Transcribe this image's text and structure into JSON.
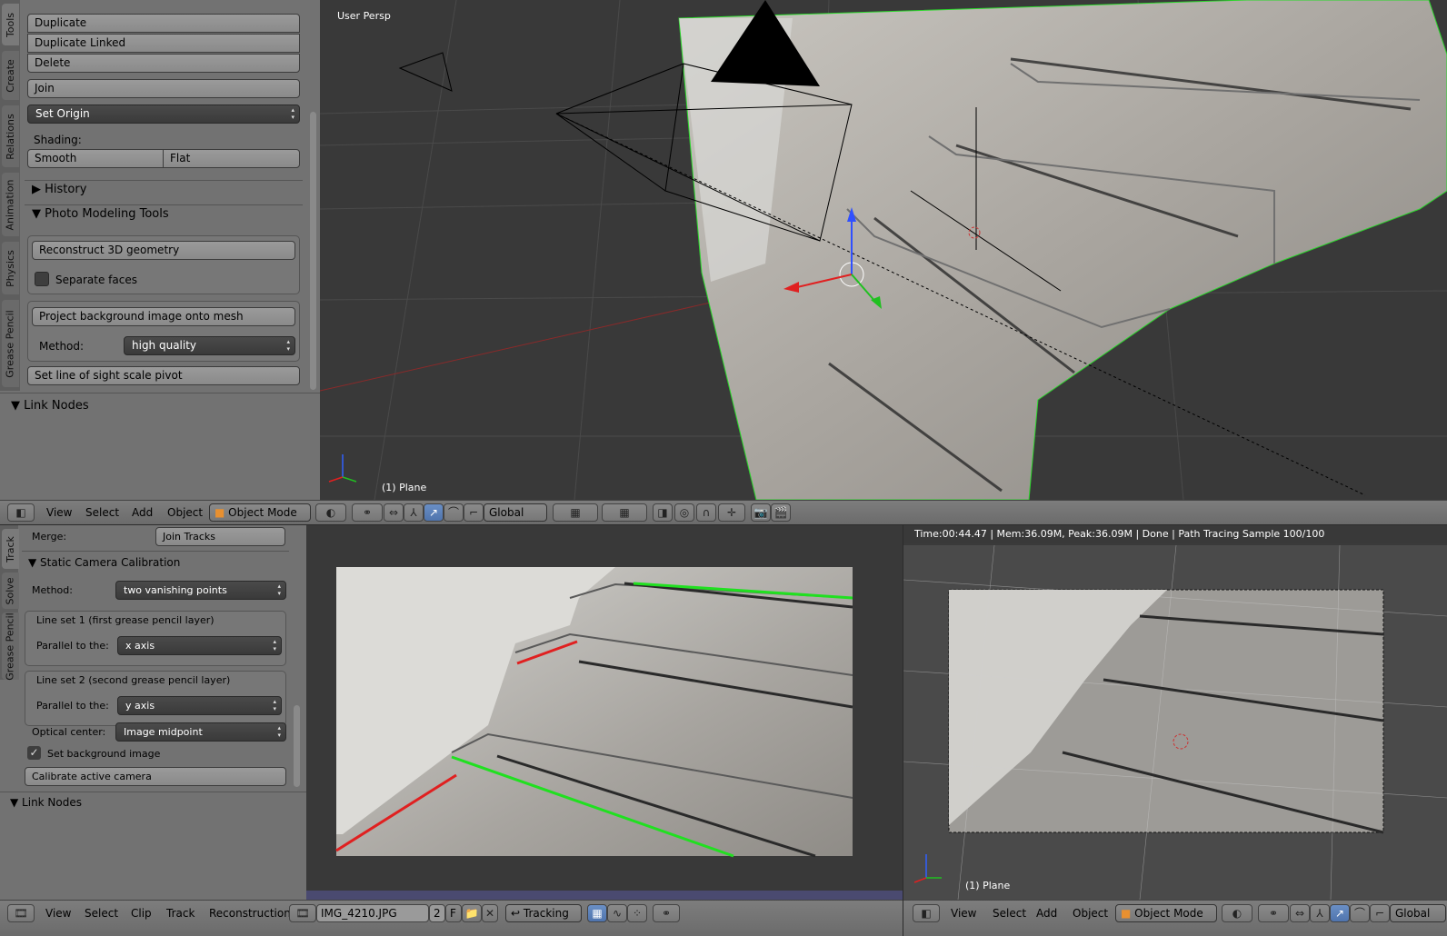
{
  "tool_panel": {
    "tabs": [
      "Tools",
      "Create",
      "Relations",
      "Animation",
      "Physics",
      "Grease Pencil"
    ],
    "buttons": {
      "duplicate": "Duplicate",
      "duplicate_linked": "Duplicate Linked",
      "delete": "Delete",
      "join": "Join"
    },
    "set_origin": "Set Origin",
    "shading_label": "Shading:",
    "smooth": "Smooth",
    "flat": "Flat",
    "history": "History",
    "photo_modeling": "Photo Modeling Tools",
    "reconstruct": "Reconstruct 3D geometry",
    "separate_faces": "Separate faces",
    "separate_faces_checked": false,
    "project": "Project background image onto mesh",
    "method_label": "Method:",
    "method_value": "high quality",
    "scale_pivot": "Set line of sight scale pivot",
    "link_nodes": "Link Nodes"
  },
  "viewport_top": {
    "title": "User Persp",
    "object": "(1) Plane"
  },
  "header_3d": {
    "menus": [
      "View",
      "Select",
      "Add",
      "Object"
    ],
    "mode": "Object Mode",
    "orientation": "Global"
  },
  "clip_panel": {
    "tabs": [
      "Track",
      "Solve",
      "Grease Pencil"
    ],
    "merge_label": "Merge:",
    "join_tracks": "Join Tracks",
    "section": "Static Camera Calibration",
    "method_label": "Method:",
    "method_value": "two vanishing points",
    "lineset1": "Line set 1 (first grease pencil layer)",
    "parallel_label": "Parallel to the:",
    "lineset1_axis": "x axis",
    "lineset2": "Line set 2 (second grease pencil layer)",
    "lineset2_axis": "y axis",
    "optical_label": "Optical center:",
    "optical_value": "Image midpoint",
    "set_bg": "Set background image",
    "set_bg_checked": true,
    "calibrate": "Calibrate active camera",
    "link_nodes": "Link Nodes"
  },
  "render_view": {
    "status": "Time:00:44.47 | Mem:36.09M, Peak:36.09M | Done | Path Tracing Sample 100/100",
    "object": "(1) Plane"
  },
  "header_clip": {
    "menus": [
      "View",
      "Select",
      "Clip",
      "Track",
      "Reconstruction"
    ],
    "clip_name": "IMG_4210.JPG",
    "users": "2",
    "fake": "F",
    "mode": "Tracking"
  },
  "header_3d_right": {
    "menus": [
      "View",
      "Select",
      "Add",
      "Object"
    ],
    "mode": "Object Mode",
    "orientation": "Global"
  },
  "colors": {
    "panel": "#727272",
    "viewport": "#393939",
    "line_x": "#e02020",
    "line_y": "#20e020",
    "selected_outline": "#2bd82b"
  }
}
